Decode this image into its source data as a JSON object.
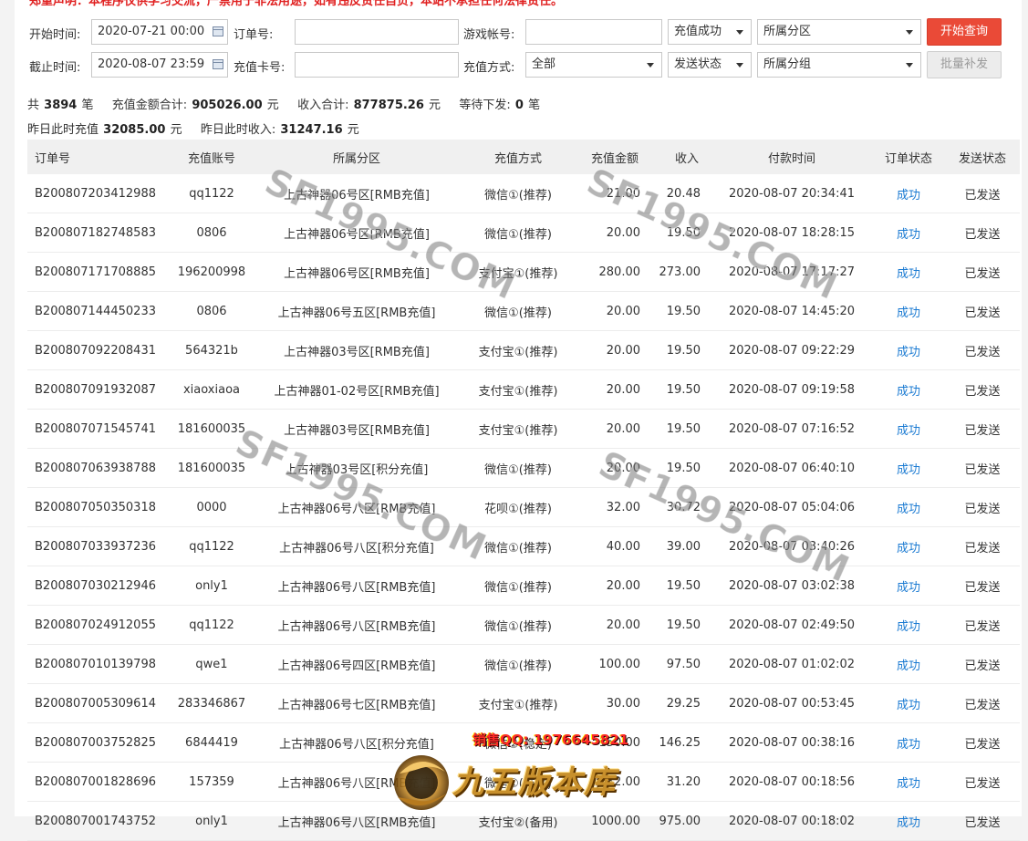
{
  "notice": "郑重声明：本程序仅供学习交流，严禁用于非法用途，如有违反责任自负，本站不承担任何法律责任。",
  "filters": {
    "start_time_label": "开始时间:",
    "start_time_value": "2020-07-21 00:00",
    "end_time_label": "截止时间:",
    "end_time_value": "2020-08-07 23:59",
    "order_no_label": "订单号:",
    "order_no_value": "",
    "card_no_label": "充值卡号:",
    "card_no_value": "",
    "game_account_label": "游戏帐号:",
    "game_account_value": "",
    "pay_method_label": "充值方式:",
    "pay_method_value": "全部",
    "recharge_status_value": "充值成功",
    "send_status_value": "发送状态",
    "zone_value": "所属分区",
    "group_value": "所属分组",
    "query_button": "开始查询",
    "batch_button": "批量补发"
  },
  "summary": {
    "total_prefix": "共",
    "total_count": "3894",
    "total_suffix": "笔",
    "amount_label": "充值金额合计:",
    "amount_value": "905026.00",
    "amount_unit": "元",
    "income_label": "收入合计:",
    "income_value": "877875.26",
    "income_unit": "元",
    "pending_label": "等待下发:",
    "pending_value": "0",
    "pending_unit": "笔",
    "yesterday_recharge_label": "昨日此时充值",
    "yesterday_recharge_value": "32085.00",
    "yesterday_recharge_unit": "元",
    "yesterday_income_label": "昨日此时收入:",
    "yesterday_income_value": "31247.16",
    "yesterday_income_unit": "元"
  },
  "table": {
    "headers": {
      "order": "订单号",
      "account": "充值账号",
      "zone": "所属分区",
      "pay": "充值方式",
      "amount": "充值金额",
      "income": "收入",
      "time": "付款时间",
      "order_status": "订单状态",
      "send_status": "发送状态"
    },
    "rows": [
      {
        "order": "B200807203412988",
        "account": "qq1122",
        "zone": "上古神器06号区[RMB充值]",
        "pay": "微信①(推荐)",
        "amount": "21.00",
        "income": "20.48",
        "time": "2020-08-07 20:34:41",
        "order_status": "成功",
        "send_status": "已发送"
      },
      {
        "order": "B200807182748583",
        "account": "0806",
        "zone": "上古神器06号区[RMB充值]",
        "pay": "微信①(推荐)",
        "amount": "20.00",
        "income": "19.50",
        "time": "2020-08-07 18:28:15",
        "order_status": "成功",
        "send_status": "已发送"
      },
      {
        "order": "B200807171708885",
        "account": "196200998",
        "zone": "上古神器06号区[RMB充值]",
        "pay": "支付宝①(推荐)",
        "amount": "280.00",
        "income": "273.00",
        "time": "2020-08-07 17:17:27",
        "order_status": "成功",
        "send_status": "已发送"
      },
      {
        "order": "B200807144450233",
        "account": "0806",
        "zone": "上古神器06号五区[RMB充值]",
        "pay": "微信①(推荐)",
        "amount": "20.00",
        "income": "19.50",
        "time": "2020-08-07 14:45:20",
        "order_status": "成功",
        "send_status": "已发送"
      },
      {
        "order": "B200807092208431",
        "account": "564321b",
        "zone": "上古神器03号区[RMB充值]",
        "pay": "支付宝①(推荐)",
        "amount": "20.00",
        "income": "19.50",
        "time": "2020-08-07 09:22:29",
        "order_status": "成功",
        "send_status": "已发送"
      },
      {
        "order": "B200807091932087",
        "account": "xiaoxiaoa",
        "zone": "上古神器01-02号区[RMB充值]",
        "pay": "支付宝①(推荐)",
        "amount": "20.00",
        "income": "19.50",
        "time": "2020-08-07 09:19:58",
        "order_status": "成功",
        "send_status": "已发送"
      },
      {
        "order": "B200807071545741",
        "account": "181600035",
        "zone": "上古神器03号区[RMB充值]",
        "pay": "支付宝①(推荐)",
        "amount": "20.00",
        "income": "19.50",
        "time": "2020-08-07 07:16:52",
        "order_status": "成功",
        "send_status": "已发送"
      },
      {
        "order": "B200807063938788",
        "account": "181600035",
        "zone": "上古神器03号区[积分充值]",
        "pay": "微信①(推荐)",
        "amount": "20.00",
        "income": "19.50",
        "time": "2020-08-07 06:40:10",
        "order_status": "成功",
        "send_status": "已发送"
      },
      {
        "order": "B200807050350318",
        "account": "0000",
        "zone": "上古神器06号八区[RMB充值]",
        "pay": "花呗①(推荐)",
        "amount": "32.00",
        "income": "30.72",
        "time": "2020-08-07 05:04:06",
        "order_status": "成功",
        "send_status": "已发送"
      },
      {
        "order": "B200807033937236",
        "account": "qq1122",
        "zone": "上古神器06号八区[积分充值]",
        "pay": "微信①(推荐)",
        "amount": "40.00",
        "income": "39.00",
        "time": "2020-08-07 03:40:26",
        "order_status": "成功",
        "send_status": "已发送"
      },
      {
        "order": "B200807030212946",
        "account": "only1",
        "zone": "上古神器06号八区[RMB充值]",
        "pay": "微信①(推荐)",
        "amount": "20.00",
        "income": "19.50",
        "time": "2020-08-07 03:02:38",
        "order_status": "成功",
        "send_status": "已发送"
      },
      {
        "order": "B200807024912055",
        "account": "qq1122",
        "zone": "上古神器06号八区[RMB充值]",
        "pay": "微信①(推荐)",
        "amount": "20.00",
        "income": "19.50",
        "time": "2020-08-07 02:49:50",
        "order_status": "成功",
        "send_status": "已发送"
      },
      {
        "order": "B200807010139798",
        "account": "qwe1",
        "zone": "上古神器06号四区[RMB充值]",
        "pay": "微信①(推荐)",
        "amount": "100.00",
        "income": "97.50",
        "time": "2020-08-07 01:02:02",
        "order_status": "成功",
        "send_status": "已发送"
      },
      {
        "order": "B200807005309614",
        "account": "283346867",
        "zone": "上古神器06号七区[RMB充值]",
        "pay": "支付宝①(推荐)",
        "amount": "30.00",
        "income": "29.25",
        "time": "2020-08-07 00:53:45",
        "order_status": "成功",
        "send_status": "已发送"
      },
      {
        "order": "B200807003752825",
        "account": "6844419",
        "zone": "上古神器06号八区[积分充值]",
        "pay": "微信②(稳定)",
        "amount": "150.00",
        "income": "146.25",
        "time": "2020-08-07 00:38:16",
        "order_status": "成功",
        "send_status": "已发送"
      },
      {
        "order": "B200807001828696",
        "account": "157359",
        "zone": "上古神器06号八区[RMB充值]",
        "pay": "微信①(推荐)",
        "amount": "32.00",
        "income": "31.20",
        "time": "2020-08-07 00:18:56",
        "order_status": "成功",
        "send_status": "已发送"
      },
      {
        "order": "B200807001743752",
        "account": "only1",
        "zone": "上古神器06号八区[RMB充值]",
        "pay": "支付宝②(备用)",
        "amount": "1000.00",
        "income": "975.00",
        "time": "2020-08-07 00:18:02",
        "order_status": "成功",
        "send_status": "已发送"
      }
    ]
  },
  "watermark_text": "SF1995.COM",
  "promo": {
    "qq": "销售QQ: 1976645821",
    "logo_text": "九五版本库"
  }
}
